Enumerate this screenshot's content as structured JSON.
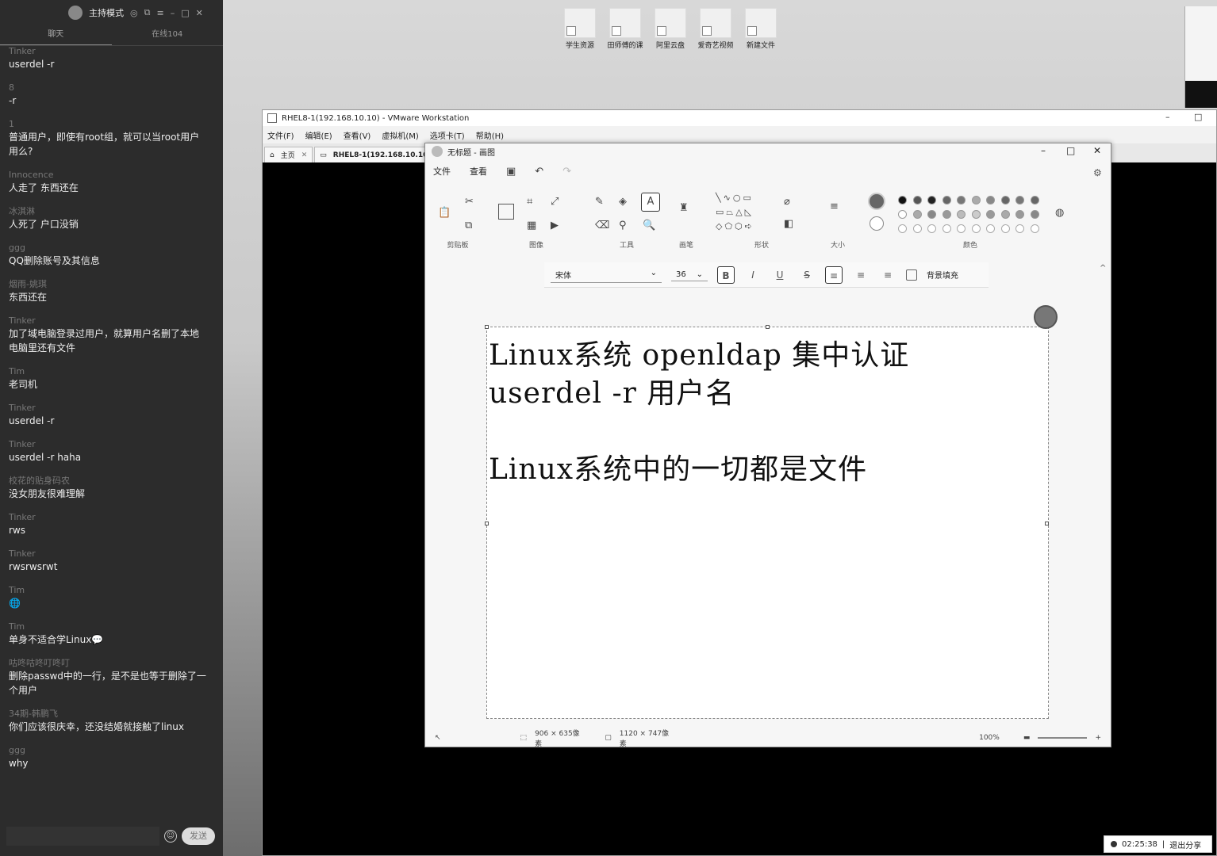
{
  "chat": {
    "title": "主持模式",
    "tabs": [
      "聊天",
      "在线104"
    ],
    "messages": [
      {
        "user": "Tinker",
        "text": "userdel -r"
      },
      {
        "user": "8",
        "text": "-r"
      },
      {
        "user": "1",
        "text": "普通用户，即使有root组，就可以当root用户用么?"
      },
      {
        "user": "Innocence",
        "text": "人走了 东西还在"
      },
      {
        "user": "冰淇淋",
        "text": "人死了 户口没销"
      },
      {
        "user": "ggg",
        "text": "QQ删除账号及其信息"
      },
      {
        "user": "烟雨-姚琪",
        "text": "东西还在"
      },
      {
        "user": "Tinker",
        "text": "加了域电脑登录过用户，就算用户名删了本地电脑里还有文件"
      },
      {
        "user": "Tim",
        "text": "老司机"
      },
      {
        "user": "Tinker",
        "text": "userdel -r"
      },
      {
        "user": "Tinker",
        "text": "userdel -r haha"
      },
      {
        "user": "校花的贴身码农",
        "text": "没女朋友很难理解"
      },
      {
        "user": "Tinker",
        "text": "rws"
      },
      {
        "user": "Tinker",
        "text": "rwsrwsrwt"
      },
      {
        "user": "Tim",
        "text": "🌐"
      },
      {
        "user": "Tim",
        "text": "单身不适合学Linux💬"
      },
      {
        "user": "咕咚咕咚叮咚叮",
        "text": "删除passwd中的一行，是不是也等于删除了一个用户"
      },
      {
        "user": "34期-韩鹏飞",
        "text": "你们应该很庆幸，还没结婚就接触了linux"
      },
      {
        "user": "ggg",
        "text": "why"
      }
    ],
    "input_placeholder": "",
    "send_label": "发送"
  },
  "desktop": {
    "shortcuts": [
      "学生资源",
      "田师傅的课",
      "阿里云盘",
      "爱奇艺视频",
      "新建文件"
    ]
  },
  "vmware": {
    "title": "RHEL8-1(192.168.10.10) - VMware Workstation",
    "menu": [
      "文件(F)",
      "编辑(E)",
      "查看(V)",
      "虚拟机(M)",
      "选项卡(T)",
      "帮助(H)"
    ],
    "tabs": [
      "主页",
      "RHEL8-1(192.168.10.10)"
    ]
  },
  "paint": {
    "title": "无标题 - 画图",
    "menu": [
      "文件",
      "查看"
    ],
    "groups": [
      "剪贴板",
      "图像",
      "工具",
      "画笔",
      "形状",
      "大小",
      "颜色"
    ],
    "font": "宋体",
    "font_size": "36",
    "fill_label": "背景填充",
    "text_lines": [
      "Linux系统 openldap 集中认证",
      "userdel -r 用户名",
      "",
      "Linux系统中的一切都是文件"
    ],
    "status": {
      "selection": "906 × 635像素",
      "canvas": "1120 × 747像素",
      "zoom": "100%"
    },
    "palette_row1": [
      "#111111",
      "#555555",
      "#222222",
      "#666666",
      "#777777",
      "#aaaaaa",
      "#888888",
      "#666666",
      "#777777",
      "#666666"
    ],
    "palette_row2": [
      "#ffffff",
      "#aaaaaa",
      "#888888",
      "#999999",
      "#bbbbbb",
      "#cccccc",
      "#999999",
      "#aaaaaa",
      "#999999",
      "#888888"
    ]
  },
  "share": {
    "time": "02:25:38",
    "exit_label": "退出分享"
  }
}
